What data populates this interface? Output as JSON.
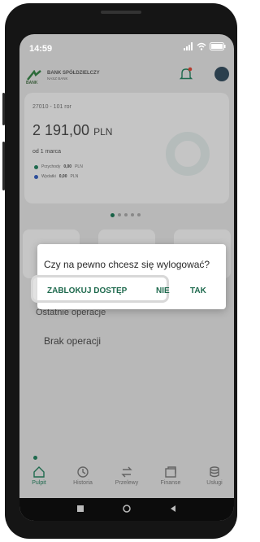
{
  "status": {
    "time": "14:59"
  },
  "bank": {
    "name": "BANK SPÓŁDZIELCZY",
    "subtitle": "NASZ BANK",
    "logo_text": "BANK"
  },
  "account": {
    "number": "27010 - 101 ror",
    "balance": "2 191,00",
    "currency": "PLN",
    "since": "od 1 marca",
    "income_label": "Przychody",
    "income_value": "0,00",
    "income_currency": "PLN",
    "expense_label": "Wydatki",
    "expense_value": "0,00",
    "expense_currency": "PLN"
  },
  "recent": {
    "title": "Ostatnie operacje",
    "empty": "Brak operacji"
  },
  "dialog": {
    "message": "Czy na pewno chcesz się wylogować?",
    "lock_label": "ZABLOKUJ DOSTĘP",
    "no_label": "NIE",
    "yes_label": "TAK"
  },
  "nav": {
    "items": [
      {
        "label": "Pulpit",
        "icon": "home-icon"
      },
      {
        "label": "Historia",
        "icon": "history-icon"
      },
      {
        "label": "Przelewy",
        "icon": "transfer-icon"
      },
      {
        "label": "Finanse",
        "icon": "finance-icon"
      },
      {
        "label": "Usługi",
        "icon": "services-icon"
      }
    ]
  },
  "colors": {
    "accent": "#1f6a4e",
    "income": "#1f6a4e",
    "expense": "#2e4f9b"
  }
}
